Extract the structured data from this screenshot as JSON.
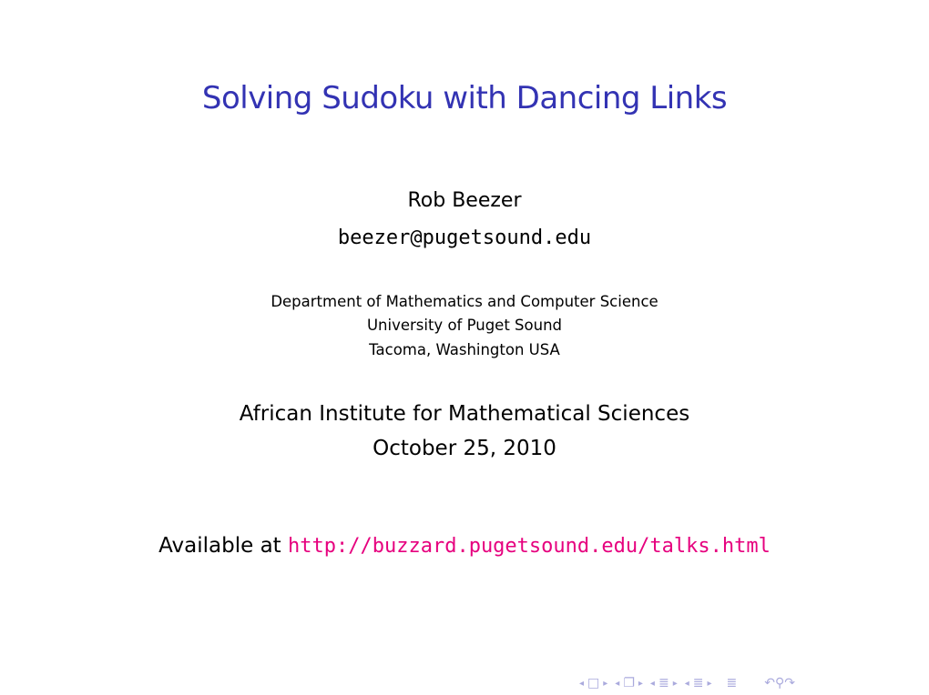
{
  "slide": {
    "title": "Solving Sudoku with Dancing Links",
    "author": "Rob Beezer",
    "email": "beezer@pugetsound.edu",
    "institution": [
      "Department of Mathematics and Computer Science",
      "University of Puget Sound",
      "Tacoma, Washington USA"
    ],
    "event": "African Institute for Mathematical Sciences",
    "date": "October 25, 2010",
    "availability_prefix": "Available at ",
    "url": "http://buzzard.pugetsound.edu/talks.html"
  },
  "colors": {
    "title": "#3333b3",
    "url": "#e6007e",
    "nav": "#aaaadd"
  },
  "navigation": {
    "icons": [
      "frame-prev-icon",
      "frame-icon",
      "frame-next-icon",
      "slide-prev-icon",
      "slide-icon",
      "slide-next-icon",
      "section-prev-icon",
      "section-icon",
      "section-next-icon",
      "subsection-prev-icon",
      "subsection-icon",
      "subsection-next-icon",
      "toc-icon",
      "undo-icon",
      "search-icon",
      "redo-icon"
    ]
  }
}
